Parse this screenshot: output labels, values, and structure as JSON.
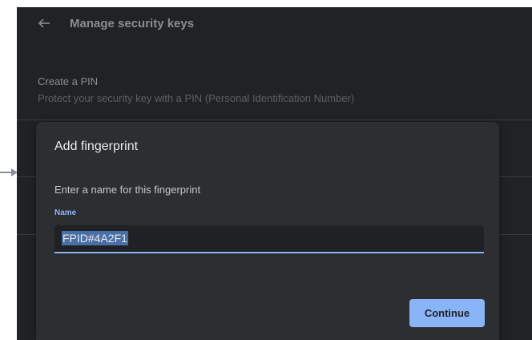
{
  "header": {
    "title": "Manage security keys",
    "back_icon": "back-arrow-icon"
  },
  "pin_row": {
    "title": "Create a PIN",
    "description": "Protect your security key with a PIN (Personal Identification Number)"
  },
  "dialog": {
    "title": "Add fingerprint",
    "subtitle": "Enter a name for this fingerprint",
    "field_label": "Name",
    "field_value": "FPID#4A2F1",
    "continue_label": "Continue"
  },
  "colors": {
    "panel_background": "#212225",
    "dialog_background": "#2d2e31",
    "accent": "#8ab4f8",
    "selection": "#4a6fa5"
  }
}
